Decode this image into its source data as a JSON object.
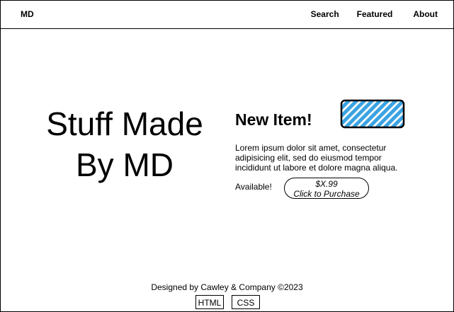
{
  "nav": {
    "logo": "MD",
    "links": [
      {
        "label": "Search"
      },
      {
        "label": "Featured"
      },
      {
        "label": "About"
      }
    ]
  },
  "hero": {
    "title_line1": "Stuff Made",
    "title_line2": "By MD"
  },
  "item": {
    "heading": "New Item!",
    "image_icon": "striped-placeholder-image",
    "image_color": "#3aa3e3",
    "description": "Lorem ipsum dolor sit amet, consectetur adipisicing elit, sed do eiusmod tempor incididunt ut labore et dolore magna aliqua.",
    "availability": "Available!",
    "price": "$X.99",
    "purchase_label": "Click to Purchase"
  },
  "footer": {
    "credit": "Designed by Cawley & Company ©2023",
    "links": [
      {
        "label": "HTML"
      },
      {
        "label": "CSS"
      }
    ]
  }
}
